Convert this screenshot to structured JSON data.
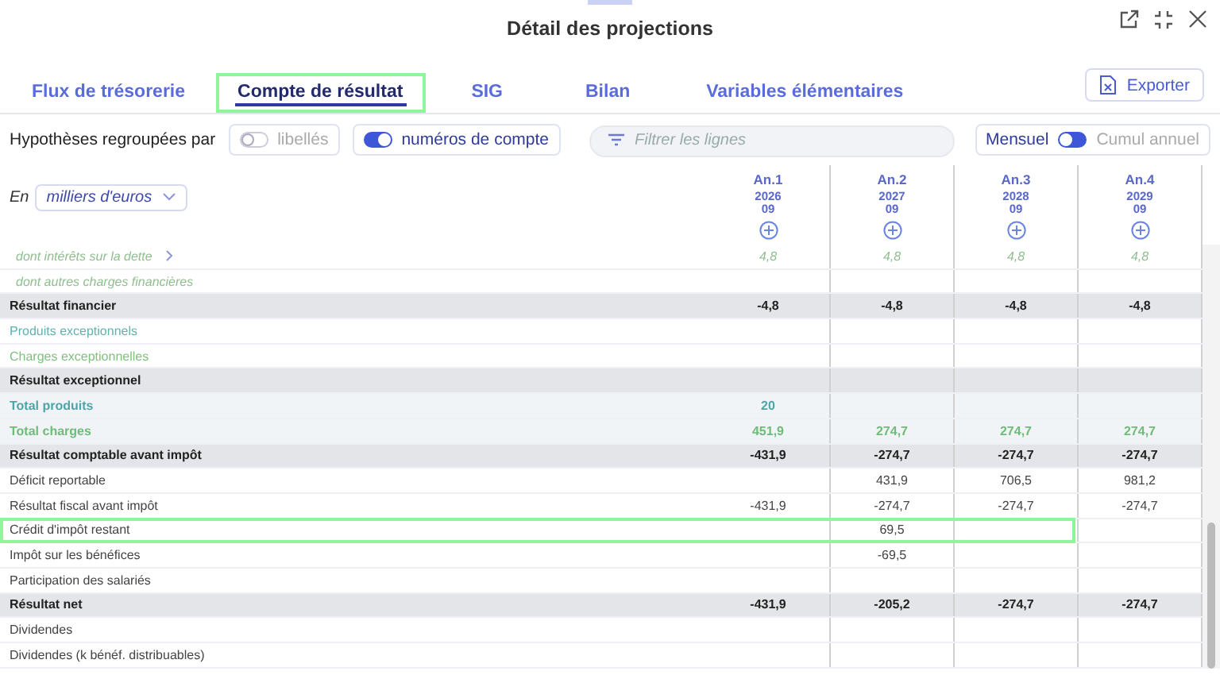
{
  "window": {
    "title": "Détail des projections"
  },
  "tabs": [
    {
      "label": "Flux de trésorerie",
      "selected": false
    },
    {
      "label": "Compte de résultat",
      "selected": true
    },
    {
      "label": "SIG",
      "selected": false
    },
    {
      "label": "Bilan",
      "selected": false
    },
    {
      "label": "Variables élémentaires",
      "selected": false
    }
  ],
  "export_button": "Exporter",
  "grouping": {
    "label": "Hypothèses regroupées par",
    "options": [
      {
        "label": "libellés",
        "on": false
      },
      {
        "label": "numéros de compte",
        "on": true
      }
    ]
  },
  "filter": {
    "placeholder": "Filtrer les lignes"
  },
  "period": {
    "left": "Mensuel",
    "right": "Cumul annuel",
    "on": false
  },
  "unit": {
    "prefix": "En",
    "value": "milliers d'euros"
  },
  "columns": [
    {
      "label": "An.1",
      "year": "2026",
      "month": "09"
    },
    {
      "label": "An.2",
      "year": "2027",
      "month": "09"
    },
    {
      "label": "An.3",
      "year": "2028",
      "month": "09"
    },
    {
      "label": "An.4",
      "year": "2029",
      "month": "09"
    }
  ],
  "rows": [
    {
      "label": "dont intérêts sur la dette",
      "kind": "sub",
      "expandable": true,
      "highlighted": false,
      "values": {
        "an_1": "4,8",
        "an_2": "4,8",
        "an_3": "4,8",
        "an_4": "4,8"
      }
    },
    {
      "label": "dont autres charges financières",
      "kind": "sub",
      "expandable": false,
      "highlighted": false
    },
    {
      "label": "Résultat financier",
      "kind": "total",
      "expandable": false,
      "highlighted": false,
      "values": {
        "an_1": "-4,8",
        "an_2": "-4,8",
        "an_3": "-4,8",
        "an_4": "-4,8"
      }
    },
    {
      "label": "Produits exceptionnels",
      "kind": "product",
      "expandable": false,
      "highlighted": false
    },
    {
      "label": "Charges exceptionnelles",
      "kind": "charge",
      "expandable": false,
      "highlighted": false
    },
    {
      "label": "Résultat exceptionnel",
      "kind": "total",
      "expandable": false,
      "highlighted": false
    },
    {
      "label": "Total produits",
      "kind": "total-product",
      "expandable": false,
      "highlighted": false,
      "values": {
        "an_1": "20"
      }
    },
    {
      "label": "Total charges",
      "kind": "total-charge",
      "expandable": false,
      "highlighted": false,
      "values": {
        "an_1": "451,9",
        "an_2": "274,7",
        "an_3": "274,7",
        "an_4": "274,7"
      }
    },
    {
      "label": "Résultat comptable avant impôt",
      "kind": "total",
      "expandable": false,
      "highlighted": false,
      "values": {
        "an_1": "-431,9",
        "an_2": "-274,7",
        "an_3": "-274,7",
        "an_4": "-274,7"
      }
    },
    {
      "label": "Déficit reportable",
      "kind": "plain",
      "expandable": false,
      "highlighted": false,
      "values": {
        "an_2": "431,9",
        "an_3": "706,5",
        "an_4": "981,2"
      }
    },
    {
      "label": "Résultat fiscal avant impôt",
      "kind": "plain",
      "expandable": false,
      "highlighted": false,
      "values": {
        "an_1": "-431,9",
        "an_2": "-274,7",
        "an_3": "-274,7",
        "an_4": "-274,7"
      }
    },
    {
      "label": "Crédit d'impôt restant",
      "kind": "plain",
      "expandable": false,
      "highlighted": true,
      "values": {
        "an_2": "69,5"
      }
    },
    {
      "label": "Impôt sur les bénéfices",
      "kind": "plain",
      "expandable": false,
      "highlighted": false,
      "values": {
        "an_2": "-69,5"
      }
    },
    {
      "label": "Participation des salariés",
      "kind": "plain",
      "expandable": false,
      "highlighted": false
    },
    {
      "label": "Résultat net",
      "kind": "total",
      "expandable": false,
      "highlighted": false,
      "values": {
        "an_1": "-431,9",
        "an_2": "-205,2",
        "an_3": "-274,7",
        "an_4": "-274,7"
      }
    },
    {
      "label": "Dividendes",
      "kind": "plain",
      "expandable": false,
      "highlighted": false
    },
    {
      "label": "Dividendes (k bénéf. distribuables)",
      "kind": "plain",
      "expandable": false,
      "highlighted": false
    }
  ]
}
